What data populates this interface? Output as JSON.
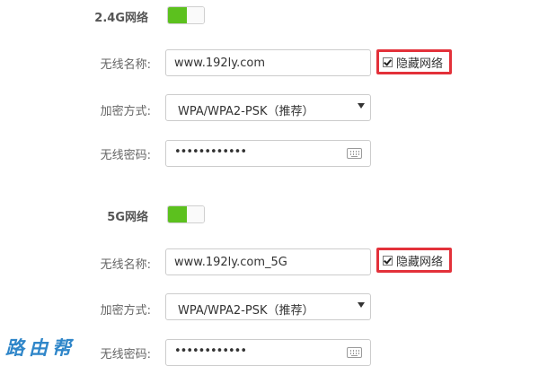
{
  "sections": [
    {
      "title": "2.4G网络",
      "toggle_on": true,
      "ssid_label": "无线名称:",
      "ssid_value": "www.192ly.com",
      "hide_label": "隐藏网络",
      "hide_checked": true,
      "enc_label": "加密方式:",
      "enc_value": "WPA/WPA2-PSK（推荐）",
      "pwd_label": "无线密码:",
      "pwd_mask": "••••••••••••"
    },
    {
      "title": "5G网络",
      "toggle_on": true,
      "ssid_label": "无线名称:",
      "ssid_value": "www.192ly.com_5G",
      "hide_label": "隐藏网络",
      "hide_checked": true,
      "enc_label": "加密方式:",
      "enc_value": "WPA/WPA2-PSK（推荐）",
      "pwd_label": "无线密码:",
      "pwd_mask": "••••••••••••"
    }
  ],
  "watermark": "路由帮",
  "colors": {
    "toggle_on": "#5cc11e",
    "highlight_border": "#e3313a",
    "watermark": "#2f86c9"
  }
}
